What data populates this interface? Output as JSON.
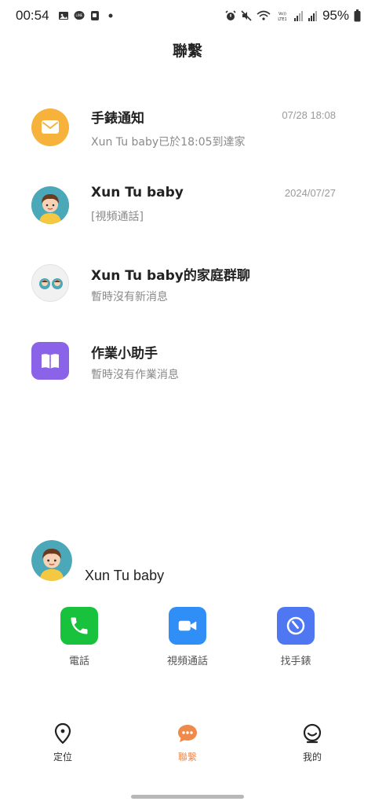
{
  "status_bar": {
    "time": "00:54",
    "battery": "95%",
    "left_icons": [
      "gallery-icon",
      "line-icon",
      "notification-icon",
      "dot-icon"
    ],
    "right_icons": [
      "alarm-icon",
      "mute-icon",
      "wifi-icon",
      "volte-icon",
      "signal-icon",
      "battery-icon"
    ]
  },
  "header": {
    "title": "聯繫"
  },
  "messages": [
    {
      "title": "手錶通知",
      "subtitle": "Xun Tu baby已於18:05到達家",
      "time": "07/28   18:08",
      "icon": "mail-icon",
      "color": "#f6b23a"
    },
    {
      "title": "Xun Tu baby",
      "subtitle": "[視頻通話]",
      "time": "2024/07/27",
      "icon": "child-avatar",
      "color": "#4aa8b8"
    },
    {
      "title": "Xun Tu baby的家庭群聊",
      "subtitle": "暫時沒有新消息",
      "time": "",
      "icon": "family-group-icon",
      "color": "#eeeeee"
    },
    {
      "title": "作業小助手",
      "subtitle": "暫時沒有作業消息",
      "time": "",
      "icon": "book-icon",
      "color": "#8a63e8"
    }
  ],
  "device": {
    "name": "Xun Tu baby"
  },
  "actions": [
    {
      "label": "電話",
      "icon": "phone-icon",
      "color": "#18c23c"
    },
    {
      "label": "視頻通話",
      "icon": "video-icon",
      "color": "#2f8ff7"
    },
    {
      "label": "找手錶",
      "icon": "find-watch-icon",
      "color": "#4f77f2"
    }
  ],
  "nav": [
    {
      "label": "定位",
      "icon": "location-icon",
      "active": false
    },
    {
      "label": "聯繫",
      "icon": "chat-icon",
      "active": true
    },
    {
      "label": "我的",
      "icon": "profile-icon",
      "active": false
    }
  ],
  "colors": {
    "accent": "#f08a4b"
  }
}
